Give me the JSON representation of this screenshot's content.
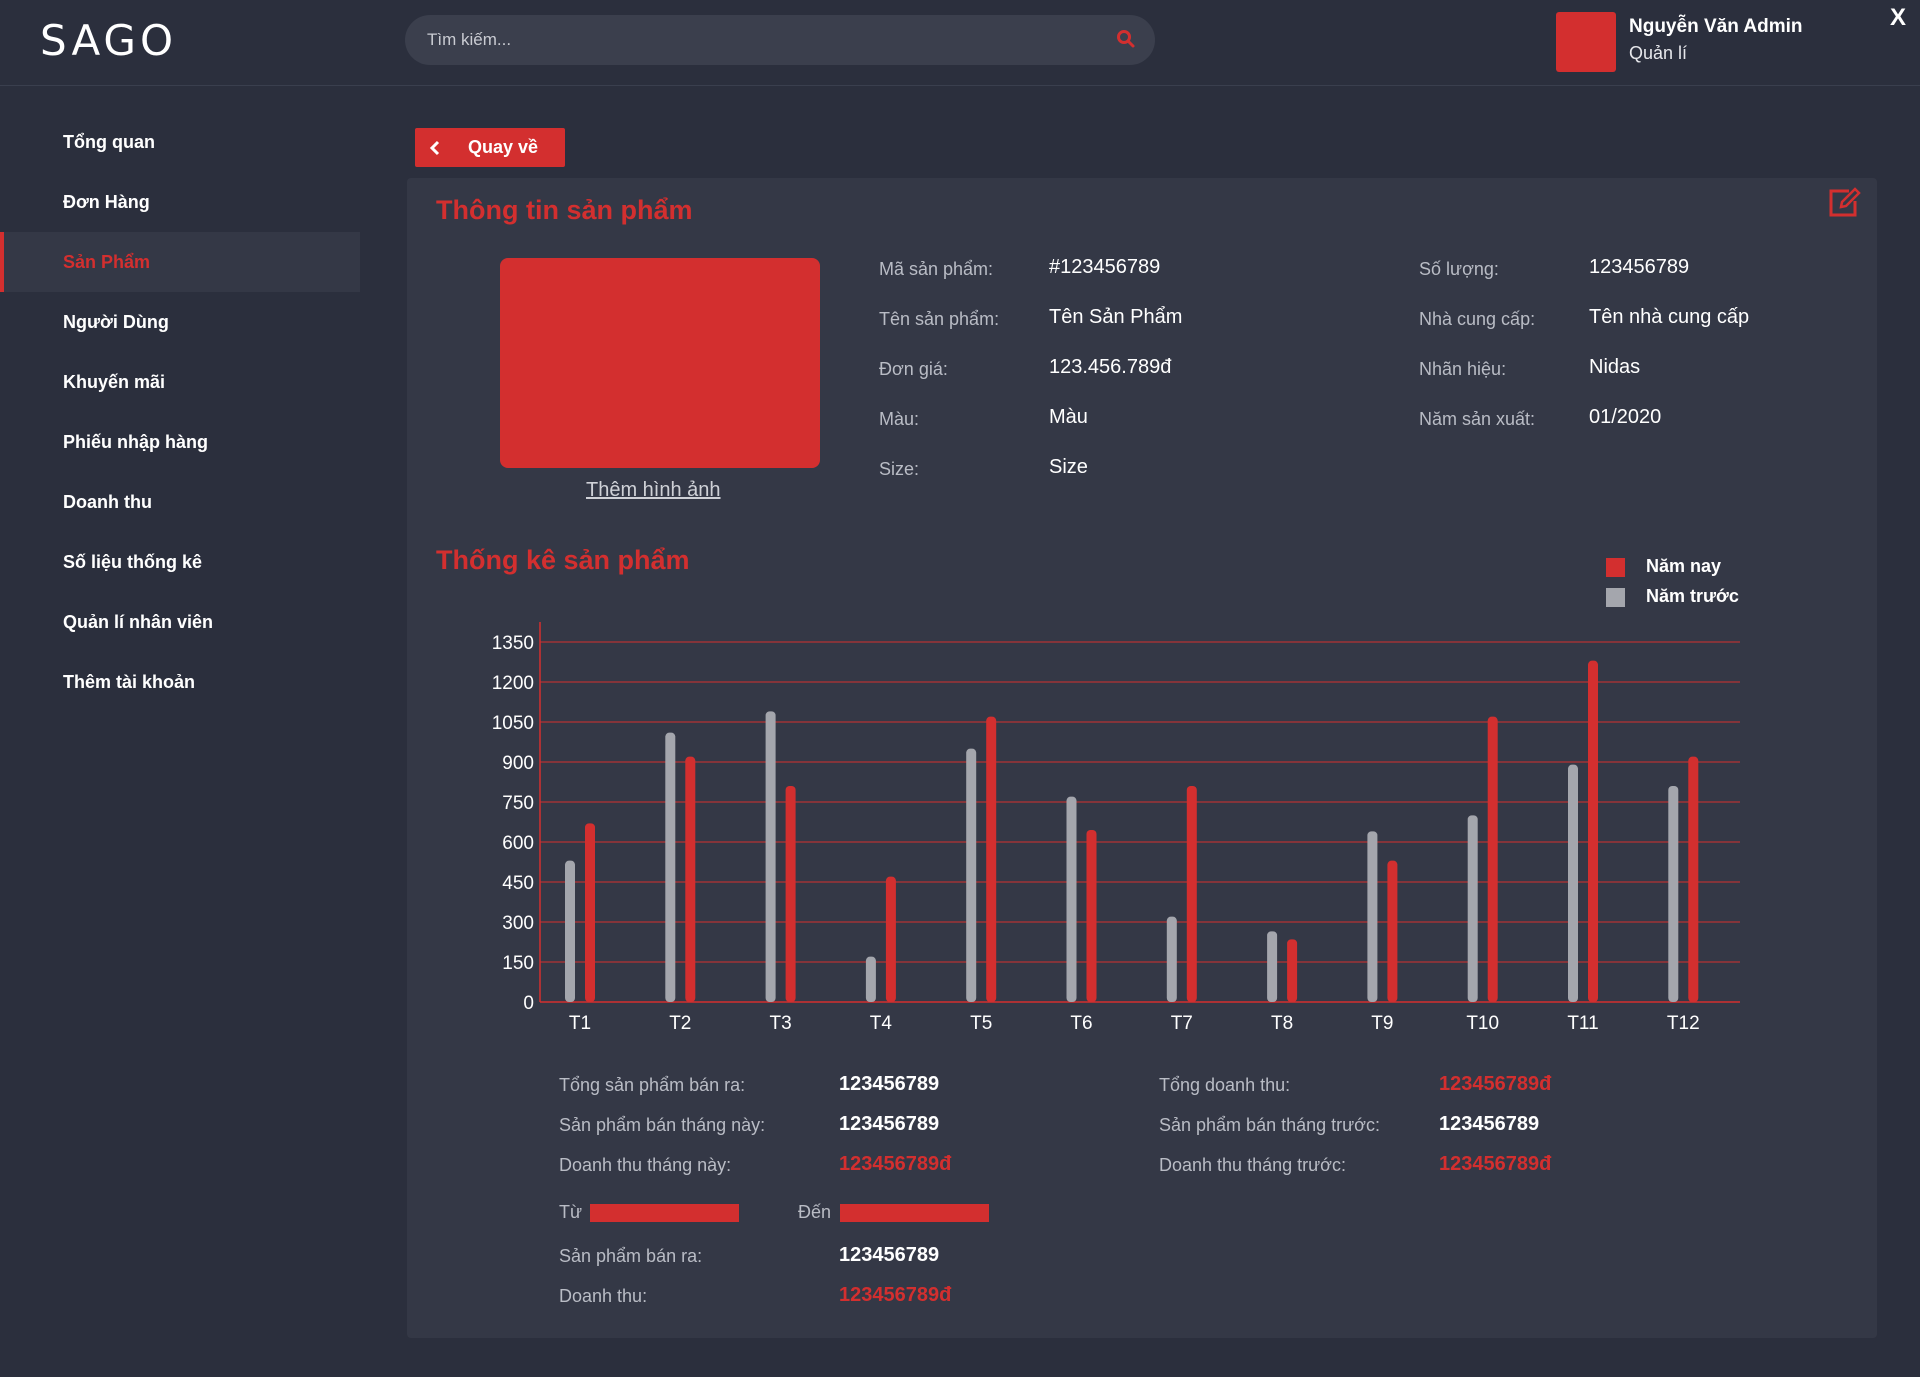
{
  "header": {
    "logo": "SAGO",
    "search_placeholder": "Tìm kiếm...",
    "user_name": "Nguyễn Văn Admin",
    "user_role": "Quản lí",
    "close_label": "X"
  },
  "sidebar": {
    "items": [
      {
        "label": "Tổng quan"
      },
      {
        "label": "Đơn Hàng"
      },
      {
        "label": "Sản Phẩm"
      },
      {
        "label": "Người Dùng"
      },
      {
        "label": "Khuyến mãi"
      },
      {
        "label": "Phiếu nhập hàng"
      },
      {
        "label": "Doanh thu"
      },
      {
        "label": "Số liệu thống kê"
      },
      {
        "label": "Quản lí nhân viên"
      },
      {
        "label": "Thêm tài khoản"
      }
    ],
    "active_index": 2
  },
  "main": {
    "back_label": "Quay về",
    "product_title": "Thông tin sản phẩm",
    "add_image_label": "Thêm hình ảnh",
    "info_left": [
      {
        "label": "Mã sản phẩm:",
        "value": "#123456789"
      },
      {
        "label": "Tên sản phẩm:",
        "value": "Tên Sản Phẩm"
      },
      {
        "label": "Đơn giá:",
        "value": "123.456.789đ"
      },
      {
        "label": "Màu:",
        "value": "Màu"
      },
      {
        "label": "Size:",
        "value": "Size"
      }
    ],
    "info_right": [
      {
        "label": "Số lượng:",
        "value": "123456789"
      },
      {
        "label": "Nhà cung cấp:",
        "value": "Tên nhà cung cấp"
      },
      {
        "label": "Nhãn hiệu:",
        "value": "Nidas"
      },
      {
        "label": "Năm sản xuất:",
        "value": "01/2020"
      }
    ],
    "stats_title": "Thống kê sản phẩm",
    "stats": {
      "total_sold_label": "Tổng sản phẩm bán ra:",
      "total_sold_value": "123456789",
      "sold_this_month_label": "Sản phẩm bán tháng này:",
      "sold_this_month_value": "123456789",
      "revenue_this_month_label": "Doanh thu tháng này:",
      "revenue_this_month_value": "123456789đ",
      "total_revenue_label": "Tổng doanh thu:",
      "total_revenue_value": "123456789đ",
      "sold_last_month_label": "Sản phẩm bán tháng trước:",
      "sold_last_month_value": "123456789",
      "revenue_last_month_label": "Doanh thu tháng trước:",
      "revenue_last_month_value": "123456789đ",
      "from_label": "Từ",
      "to_label": "Đến",
      "range_sold_label": "Sản phẩm bán ra:",
      "range_sold_value": "123456789",
      "range_revenue_label": "Doanh thu:",
      "range_revenue_value": "123456789đ"
    }
  },
  "colors": {
    "accent": "#d32f2f",
    "prev_year": "#a4a6ad",
    "background": "#2b2f3d",
    "panel": "#343846"
  },
  "chart_data": {
    "type": "bar",
    "categories": [
      "T1",
      "T2",
      "T3",
      "T4",
      "T5",
      "T6",
      "T7",
      "T8",
      "T9",
      "T10",
      "T11",
      "T12"
    ],
    "series": [
      {
        "name": "Năm trước",
        "values": [
          530,
          1010,
          1090,
          170,
          950,
          770,
          320,
          265,
          640,
          700,
          890,
          810
        ]
      },
      {
        "name": "Năm nay",
        "values": [
          670,
          920,
          810,
          470,
          1070,
          645,
          810,
          235,
          530,
          1070,
          1280,
          920
        ]
      }
    ],
    "yticks": [
      0,
      150,
      300,
      450,
      600,
      750,
      900,
      1050,
      1200,
      1350
    ],
    "ylim": [
      0,
      1350
    ],
    "grid": true,
    "legend_position": "top-right"
  }
}
